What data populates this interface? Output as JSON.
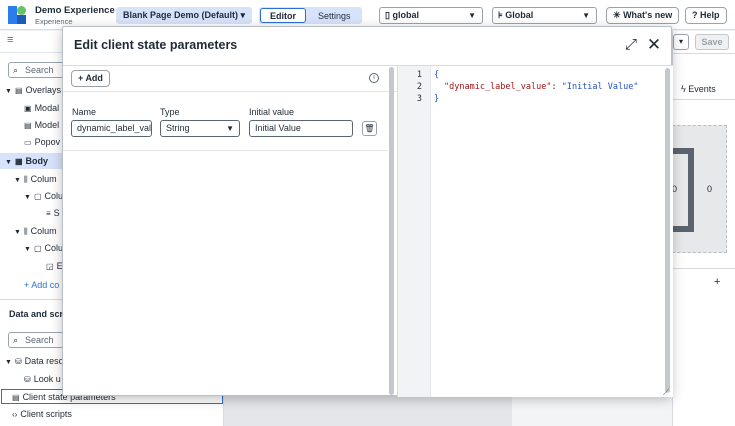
{
  "header": {
    "app_title": "Demo Experience",
    "app_subtitle": "Experience",
    "page_name": "Blank Page Demo (Default)",
    "tabs": [
      {
        "label": "Editor"
      },
      {
        "label": "Settings"
      }
    ],
    "scope_select": "global",
    "app_select": "Global",
    "whats_new": "What's new",
    "help": "Help"
  },
  "left_panel": {
    "search_placeholder": "Search",
    "tree": [
      {
        "label": "Overlays"
      },
      {
        "label": "Modal"
      },
      {
        "label": "Model"
      },
      {
        "label": "Popov"
      },
      {
        "label": "Body"
      },
      {
        "label": "Colum"
      },
      {
        "label": "Colu"
      },
      {
        "label": "S"
      },
      {
        "label": "Colum"
      },
      {
        "label": "Colu"
      },
      {
        "label": "E"
      }
    ],
    "add_component": "Add co",
    "data_section_title": "Data and scr",
    "data_search_placeholder": "Search",
    "data_items": [
      {
        "label": "Data reso"
      },
      {
        "label": "Look u"
      },
      {
        "label": "Client state parameters"
      },
      {
        "label": "Client scripts"
      }
    ]
  },
  "right_panel": {
    "events_tab": "Events",
    "save": "Save",
    "preview_value": "0",
    "preview_value_left": "0",
    "add_plus": "+"
  },
  "modal": {
    "title": "Edit client state parameters",
    "add_button": "Add",
    "columns": {
      "name": "Name",
      "type": "Type",
      "initial": "Initial value"
    },
    "param": {
      "name": "dynamic_label_value",
      "type": "String",
      "initial_value": "Initial Value"
    },
    "editor": {
      "line_numbers": [
        "1",
        "2",
        "3"
      ],
      "open_brace": "{",
      "key": "\"dynamic_label_value\"",
      "colon": ": ",
      "value": "\"Initial Value\"",
      "close_brace": "}"
    }
  }
}
